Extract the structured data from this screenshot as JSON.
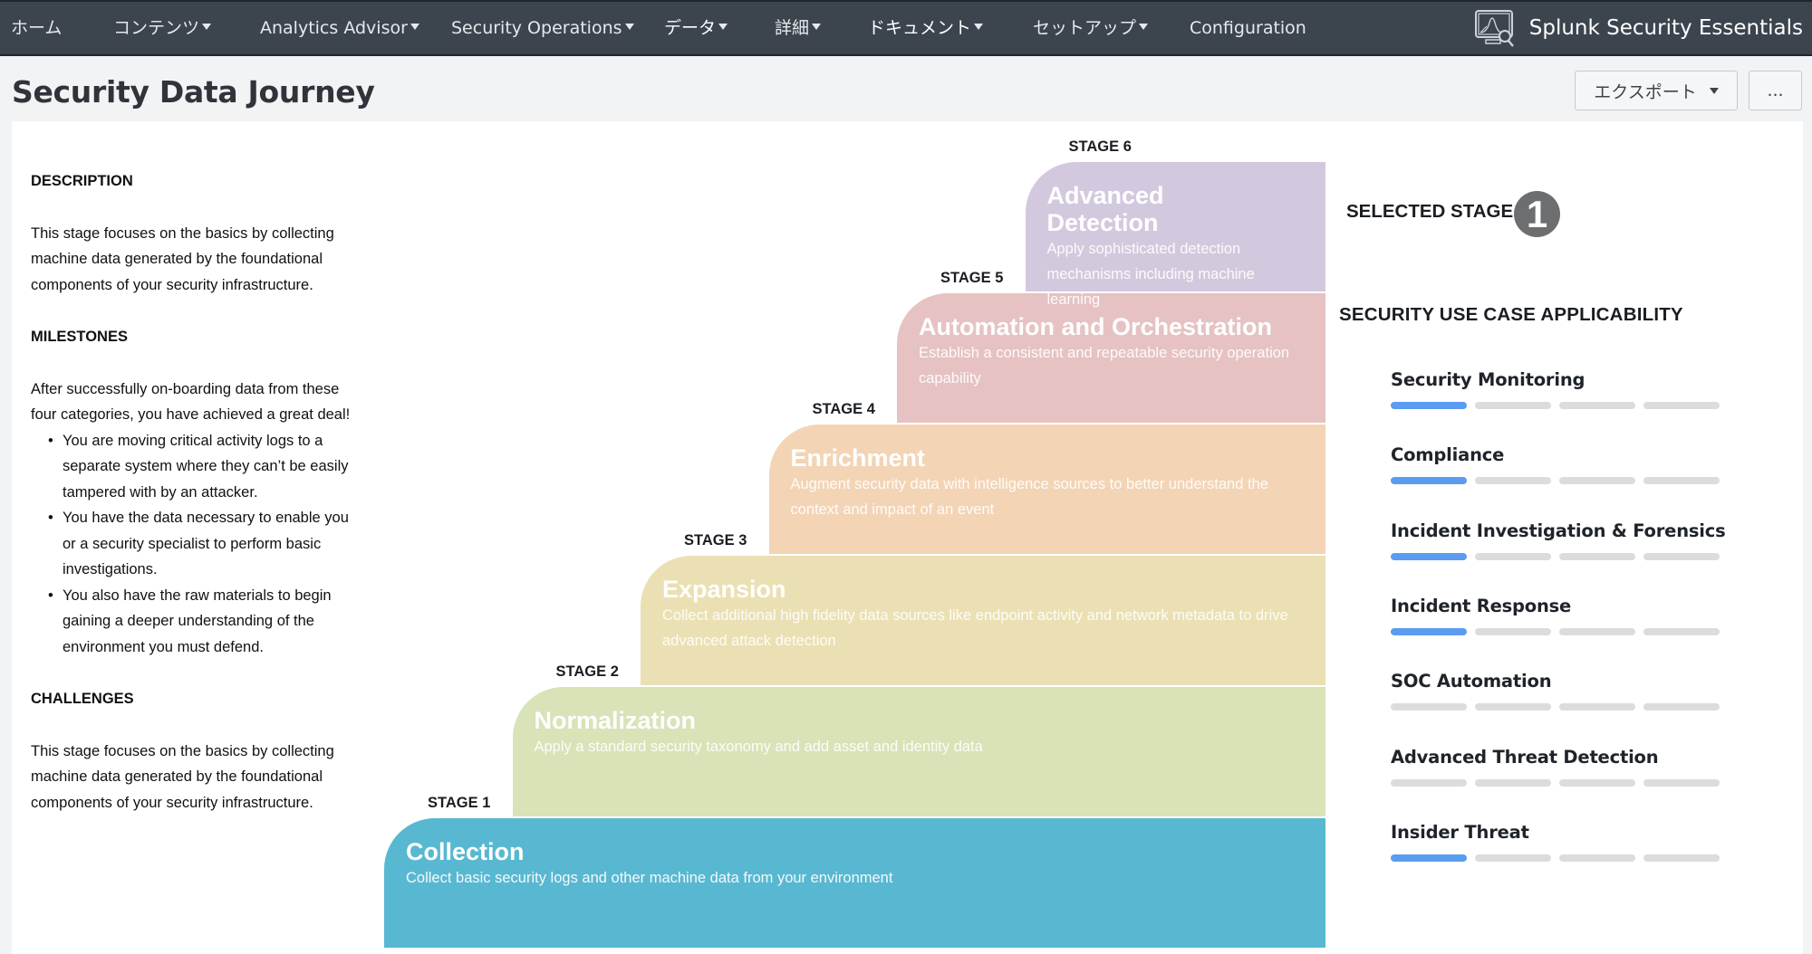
{
  "nav": {
    "items": [
      {
        "label": "ホーム",
        "dropdown": false
      },
      {
        "label": "コンテンツ",
        "dropdown": true
      },
      {
        "label": "Analytics Advisor",
        "dropdown": true
      },
      {
        "label": "Security Operations",
        "dropdown": true
      },
      {
        "label": "データ",
        "dropdown": true
      },
      {
        "label": "詳細",
        "dropdown": true
      },
      {
        "label": "ドキュメント",
        "dropdown": true
      },
      {
        "label": "セットアップ",
        "dropdown": true
      },
      {
        "label": "Configuration",
        "dropdown": false
      }
    ],
    "brand": "Splunk Security Essentials",
    "brand_icon": "monitor-chart-search-icon"
  },
  "header": {
    "title": "Security Data Journey",
    "export_label": "エクスポート",
    "more_label": "..."
  },
  "details": {
    "description_heading": "DESCRIPTION",
    "description": "This stage focuses on the basics by collecting machine data generated by the foundational components of your security infrastructure.",
    "milestones_heading": "MILESTONES",
    "milestones_intro": "After successfully on-boarding data from these four categories, you have achieved a great deal!",
    "milestones": [
      "You are moving critical activity logs to a separate system where they can’t be easily tampered with by an attacker.",
      "You have the data necessary to enable you or a security specialist to perform basic investigations.",
      "You also have the raw materials to begin gaining a deeper understanding of the environment you must defend."
    ],
    "challenges_heading": "CHALLENGES",
    "challenges": "This stage focuses on the basics by collecting machine data generated by the foundational components of your security infrastructure."
  },
  "stages": [
    {
      "label": "STAGE 1",
      "title": "Collection",
      "description": "Collect basic security logs and other machine data from your environment",
      "color": "#58b8d1"
    },
    {
      "label": "STAGE 2",
      "title": "Normalization",
      "description": "Apply a standard security taxonomy and add asset and identity data",
      "color": "#d8e3b8"
    },
    {
      "label": "STAGE 3",
      "title": "Expansion",
      "description": "Collect additional high fidelity data sources like endpoint activity and network metadata to drive advanced attack detection",
      "color": "#ebe0b3"
    },
    {
      "label": "STAGE 4",
      "title": "Enrichment",
      "description": "Augment security data with intelligence sources to better understand the context and impact of an event",
      "color": "#f3d4b5"
    },
    {
      "label": "STAGE 5",
      "title": "Automation and Orchestration",
      "description": "Establish a consistent and repeatable security operation capability",
      "color": "#e6c2c2"
    },
    {
      "label": "STAGE 6",
      "title": "Advanced Detection",
      "description": "Apply sophisticated detection mechanisms including machine learning",
      "color": "#d3c9de"
    }
  ],
  "selected": {
    "label": "SELECTED STAGE",
    "stage_number": "1"
  },
  "applicability": {
    "heading": "SECURITY USE CASE APPLICABILITY",
    "max_level": 4,
    "use_cases": [
      {
        "name": "Security Monitoring",
        "level": 1
      },
      {
        "name": "Compliance",
        "level": 1
      },
      {
        "name": "Incident Investigation & Forensics",
        "level": 1
      },
      {
        "name": "Incident Response",
        "level": 1
      },
      {
        "name": "SOC Automation",
        "level": 0
      },
      {
        "name": "Advanced Threat Detection",
        "level": 0
      },
      {
        "name": "Insider Threat",
        "level": 1
      }
    ]
  },
  "colors": {
    "nav_bg": "#3c444d",
    "bar_active": "#5b9cf0",
    "bar_inactive": "#dcdcdc",
    "badge": "#6d6e70"
  }
}
